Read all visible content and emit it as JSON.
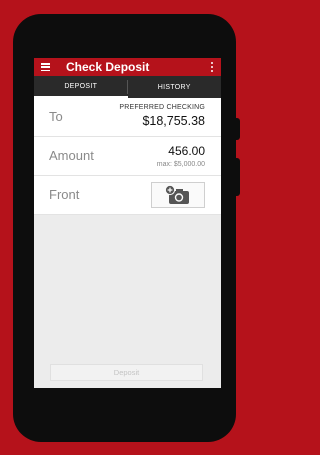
{
  "app": {
    "title": "Check Deposit",
    "menu_icon": "hamburger-icon",
    "overflow_icon": "more-vert-icon"
  },
  "tabs": [
    {
      "label": "DEPOSIT",
      "active": true
    },
    {
      "label": "HISTORY",
      "active": false
    }
  ],
  "form": {
    "to": {
      "label": "To",
      "account_name": "PREFERRED CHECKING",
      "balance": "$18,755.38"
    },
    "amount": {
      "label": "Amount",
      "value": "456.00",
      "max_text": "max: $5,000.00"
    },
    "front": {
      "label": "Front",
      "button_icon": "add-photo-camera-icon"
    }
  },
  "deposit_button": {
    "label": "Deposit",
    "enabled": false
  },
  "colors": {
    "brand": "#b5121b",
    "tab_bar": "#2a2a2a",
    "screen_bg": "#ececec"
  }
}
